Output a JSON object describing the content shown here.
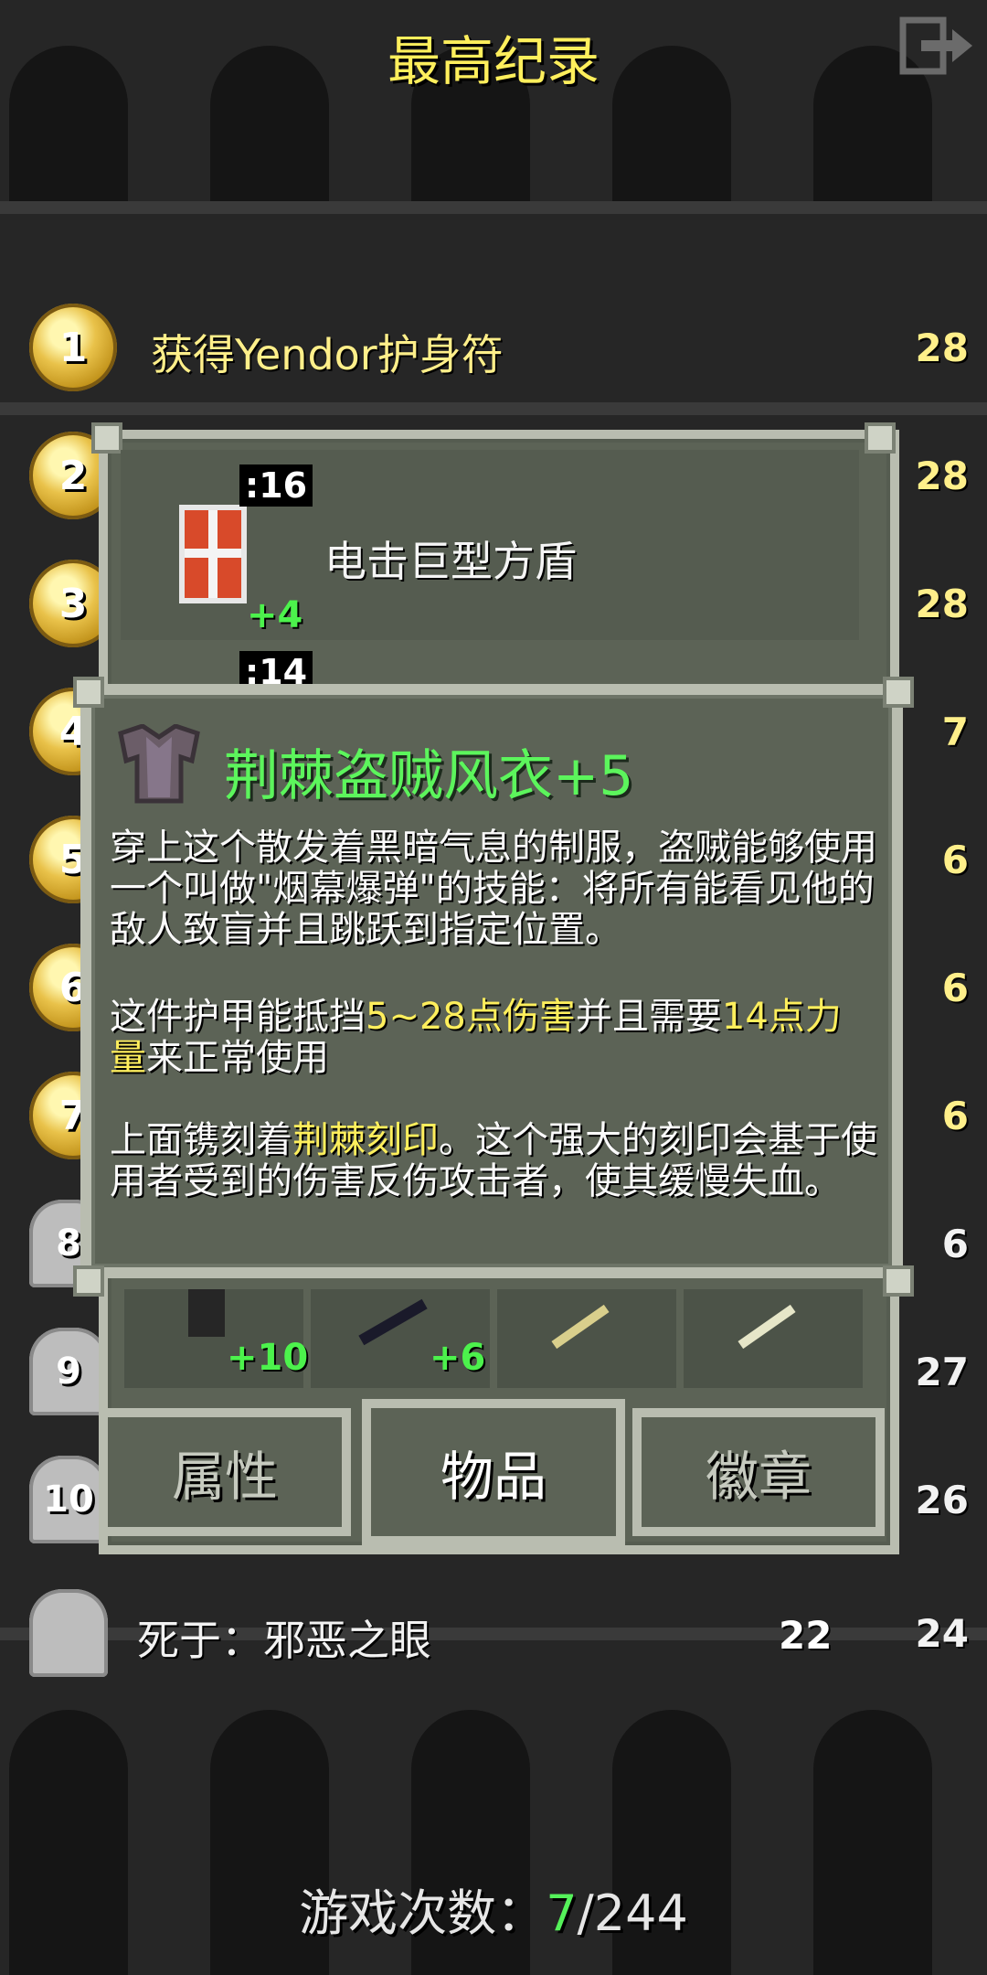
{
  "header": {
    "title": "最高纪录"
  },
  "records": [
    {
      "rank": "1",
      "text": "获得Yendor护身符",
      "level": "28",
      "type": "medal"
    },
    {
      "rank": "2",
      "level": "28",
      "type": "medal"
    },
    {
      "rank": "3",
      "level": "28",
      "type": "medal"
    },
    {
      "rank": "4",
      "level": "7",
      "type": "medal"
    },
    {
      "rank": "5",
      "level": "6",
      "type": "medal"
    },
    {
      "rank": "6",
      "level": "6",
      "type": "medal"
    },
    {
      "rank": "7",
      "level": "6",
      "type": "medal"
    },
    {
      "rank": "8",
      "level": "6",
      "type": "tomb"
    },
    {
      "rank": "9",
      "level": "27",
      "type": "tomb"
    },
    {
      "rank": "10",
      "level": "26",
      "type": "tomb"
    },
    {
      "rank": "",
      "text": "死于：邪恶之眼",
      "depth": "22",
      "level": "24",
      "type": "tomb"
    }
  ],
  "item_window": {
    "first_item": {
      "str": ":16",
      "bonus": "+4",
      "name": "电击巨型方盾"
    },
    "second_item_str": ":14",
    "bottom_slots": [
      {
        "bonus": "+10"
      },
      {
        "bonus": "+6"
      },
      {
        "bonus": ""
      },
      {
        "bonus": ""
      }
    ]
  },
  "tabs": [
    {
      "label": "属性",
      "active": false
    },
    {
      "label": "物品",
      "active": true
    },
    {
      "label": "徽章",
      "active": false
    }
  ],
  "info": {
    "title": "荆棘盗贼风衣+5",
    "p1": "穿上这个散发着黑暗气息的制服，盗贼能够使用一个叫做\"烟幕爆弹\"的技能：将所有能看见他的敌人致盲并且跳跃到指定位置。",
    "p2_a": "这件护甲能抵挡",
    "p2_hl1": "5~28点伤害",
    "p2_b": "并且需要",
    "p2_hl2": "14点力量",
    "p2_c": "来正常使用",
    "p3_a": "上面镌刻着",
    "p3_hl": "荆棘刻印",
    "p3_b": "。这个强大的刻印会基于使用者受到的伤害反伤攻击者，使其缓慢失血。"
  },
  "footer": {
    "label": "游戏次数：",
    "won": "7",
    "total": "/244"
  },
  "colors": {
    "title": "#ffef5c",
    "green": "#5cf55c",
    "highlight": "#ffef5c"
  }
}
